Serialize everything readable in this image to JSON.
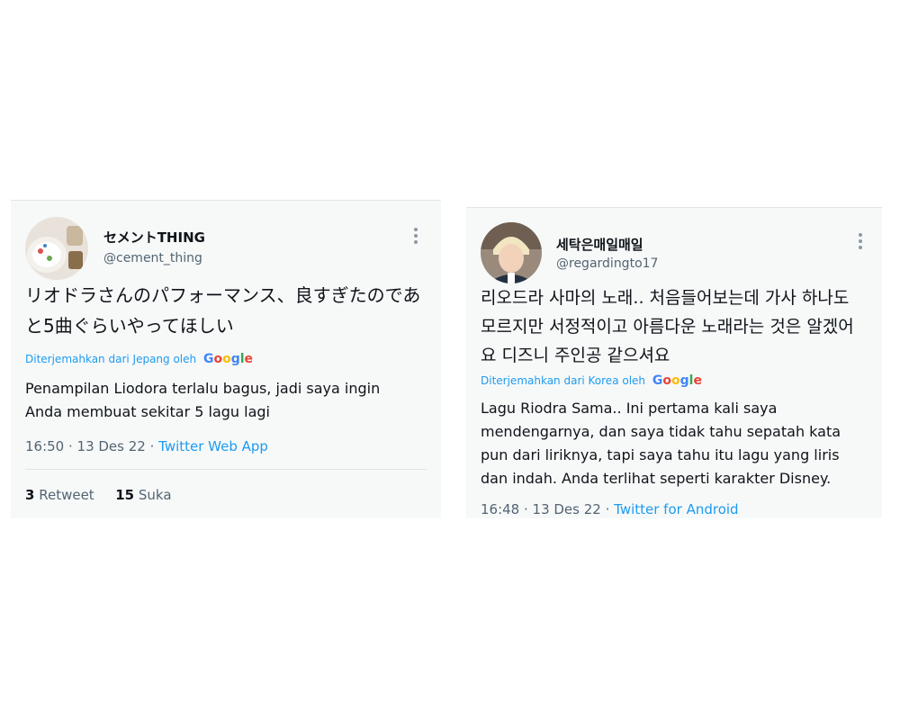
{
  "tweet1": {
    "display_name": "セメントTHING",
    "handle": "@cement_thing",
    "original_text": "リオドラさんのパフォーマンス、良すぎたのであと5曲ぐらいやってほしい",
    "translated_note": "Diterjemahkan dari Jepang oleh",
    "translated_text": "Penampilan Liodora terlalu bagus, jadi saya ingin Anda membuat sekitar 5 lagu lagi",
    "time": "16:50 · 13 Des 22 · ",
    "app": "Twitter Web App",
    "retweets": "3",
    "retweet_label": "Retweet",
    "likes": "15",
    "like_label": "Suka"
  },
  "tweet2": {
    "display_name": "세탁은매일매일",
    "handle": "@regardingto17",
    "original_text": "리오드라 사마의 노래.. 처음들어보는데 가사 하나도 모르지만 서정적이고 아름다운 노래라는 것은 알겠어요 디즈니 주인공 같으셔요",
    "translated_note": "Diterjemahkan dari Korea oleh",
    "translated_text": "Lagu Riodra Sama.. Ini pertama kali saya mendengarnya, dan saya tidak tahu sepatah kata pun dari liriknya, tapi saya tahu itu lagu yang liris dan indah. Anda terlihat seperti karakter Disney.",
    "time": "16:48 · 13 Des 22 · ",
    "app": "Twitter for Android"
  },
  "google_logo": {
    "g1": "G",
    "o1": "o",
    "o2": "o",
    "g2": "g",
    "l": "l",
    "e": "e"
  },
  "icons": {
    "more": "more-options-icon",
    "avatar1": "avatar-image",
    "avatar2": "avatar-image"
  },
  "colors": {
    "link": "#1d9bf0",
    "muted": "#536471",
    "card_bg": "#f7f9f9"
  }
}
